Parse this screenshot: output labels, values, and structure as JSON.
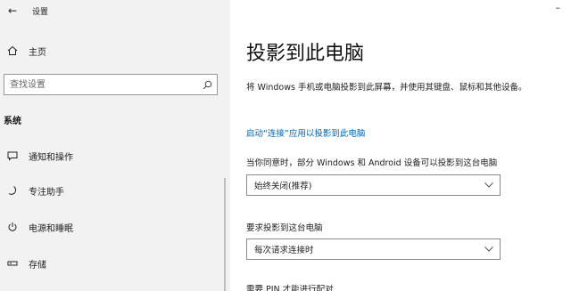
{
  "window": {
    "title": "设置",
    "back_glyph": "←",
    "minimize_glyph": "–"
  },
  "sidebar": {
    "home_label": "主页",
    "search_placeholder": "查找设置",
    "section_title": "系统",
    "items": [
      {
        "label": "通知和操作",
        "icon": "notification-icon"
      },
      {
        "label": "专注助手",
        "icon": "moon-icon"
      },
      {
        "label": "电源和睡眠",
        "icon": "power-icon"
      },
      {
        "label": "存储",
        "icon": "storage-icon"
      }
    ]
  },
  "main": {
    "title": "投影到此电脑",
    "description": "将 Windows 手机或电脑投影到此屏幕，并使用其键盘、鼠标和其他设备。",
    "link": "启动“连接”应用以投影到此电脑",
    "setting1_label": "当你同意时，部分 Windows 和 Android 设备可以投影到这台电脑",
    "setting1_value": "始终关闭(推荐)",
    "setting2_label": "要求投影到这台电脑",
    "setting2_value": "每次请求连接时",
    "setting3_label": "需要 PIN 才能进行配对"
  },
  "colors": {
    "accent": "#0063b1",
    "sidebar_bg": "#f2f2f2"
  }
}
